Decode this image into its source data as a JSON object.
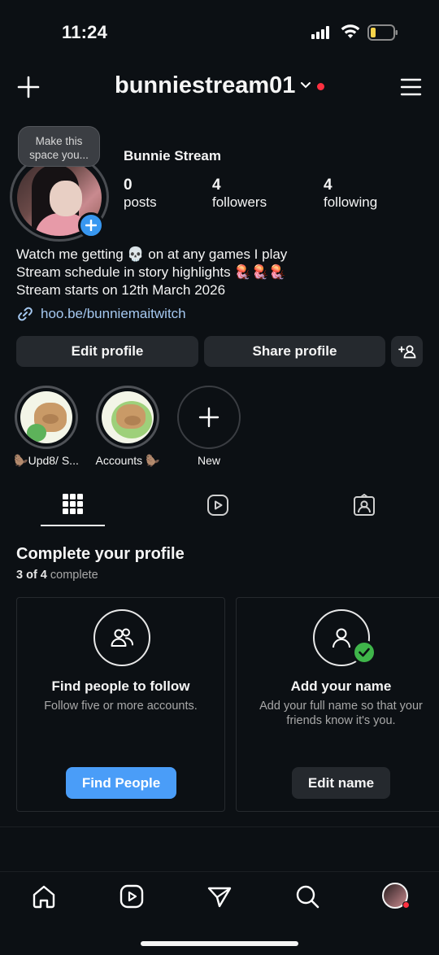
{
  "status_bar": {
    "time": "11:24"
  },
  "header": {
    "username": "bunniestream01"
  },
  "profile": {
    "tooltip": "Make this space you...",
    "tooltip_line1": "Make this",
    "tooltip_line2": "space you...",
    "display_name": "Bunnie Stream",
    "stats": [
      {
        "value": "0",
        "label": "posts"
      },
      {
        "value": "4",
        "label": "followers"
      },
      {
        "value": "4",
        "label": "following"
      }
    ],
    "bio_lines": [
      "Watch me getting 💀 on at any games I play",
      "Stream schedule in story highlights 🪼🪼🪼",
      "Stream starts on 12th March 2026"
    ],
    "link": "hoo.be/bunniemaitwitch"
  },
  "actions": {
    "edit_profile": "Edit profile",
    "share_profile": "Share profile"
  },
  "highlights": [
    {
      "label": "🦫Upd8/ S..."
    },
    {
      "label": "Accounts 🦫"
    },
    {
      "label": "New"
    }
  ],
  "complete_profile": {
    "title": "Complete your profile",
    "progress": "3 of 4",
    "progress_suffix": "complete",
    "cards": [
      {
        "title": "Find people to follow",
        "desc": "Follow five or more accounts.",
        "button": "Find People"
      },
      {
        "title": "Add your name",
        "desc_line1": "Add your full name so that your",
        "desc_line2": "friends know it's you.",
        "button": "Edit name"
      }
    ]
  },
  "colors": {
    "accent": "#4a9df8",
    "notification": "#ff3040",
    "background": "#0c1014"
  },
  "icons": [
    "plus-icon",
    "chevron-down-icon",
    "menu-icon",
    "link-icon",
    "add-person-icon",
    "grid-icon",
    "reels-icon",
    "tagged-icon",
    "people-icon",
    "user-icon",
    "check-icon",
    "home-icon",
    "send-icon",
    "search-icon"
  ]
}
